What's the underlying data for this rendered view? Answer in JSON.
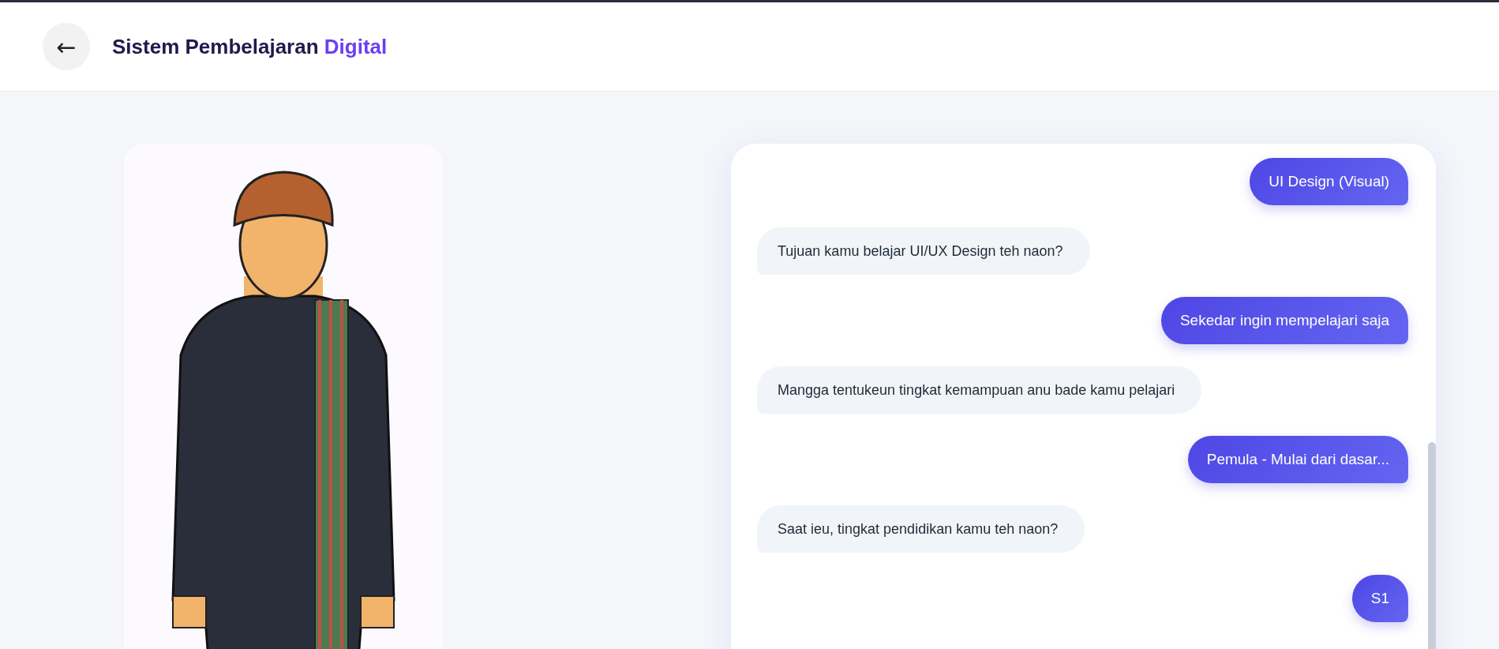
{
  "header": {
    "back_button": "←",
    "title": "Sistem Pembelajaran ",
    "title_accent": "Digital"
  },
  "messages": [
    {
      "kind": "user",
      "text": "UI Design (Visual)"
    },
    {
      "kind": "bot",
      "text": "Tujuan kamu belajar UI/UX Design teh naon?"
    },
    {
      "kind": "user",
      "text": "Sekedar ingin mempelajari saja"
    },
    {
      "kind": "bot",
      "text": "Mangga tentukeun tingkat kemampuan anu bade kamu pelajari"
    },
    {
      "kind": "user",
      "text": "Pemula - Mulai dari dasar..."
    },
    {
      "kind": "bot",
      "text": "Saat ieu, tingkat pendidikan kamu teh naon?"
    },
    {
      "kind": "user",
      "text": "S1"
    }
  ]
}
